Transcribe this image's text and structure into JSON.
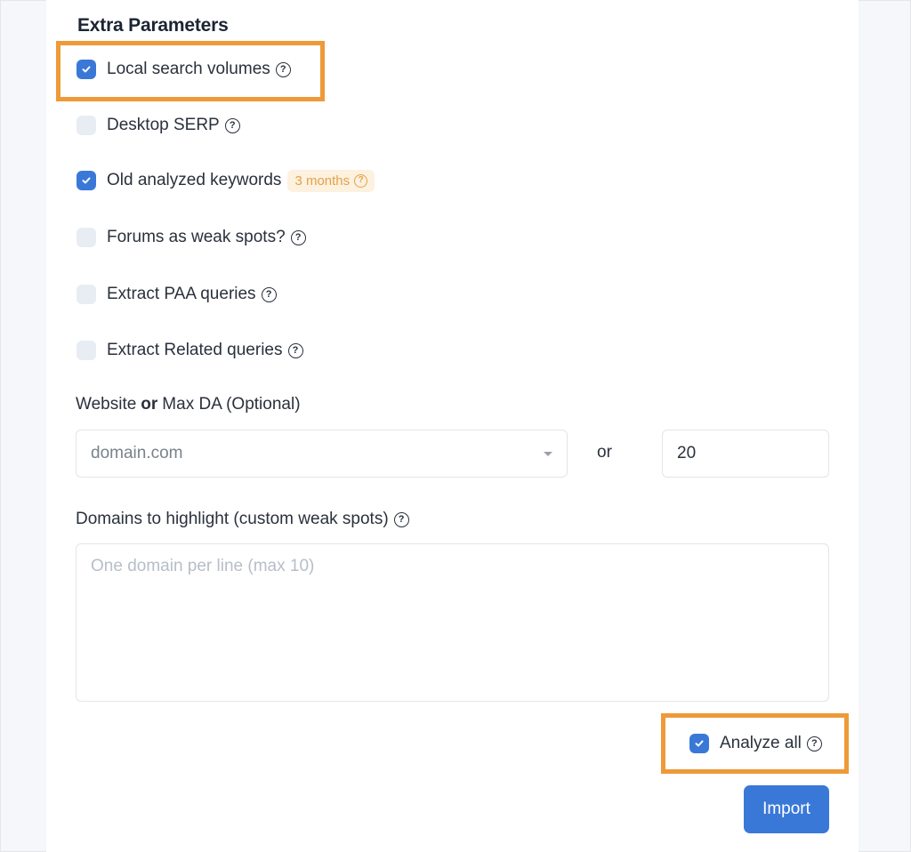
{
  "extra_parameters": {
    "title": "Extra Parameters",
    "options": [
      {
        "label": "Local search volumes",
        "checked": true,
        "help": "?"
      },
      {
        "label": "Desktop SERP",
        "checked": false,
        "help": "?"
      },
      {
        "label": "Old analyzed keywords",
        "checked": true,
        "badge": "3 months"
      },
      {
        "label": "Forums as weak spots?",
        "checked": false,
        "help": "?"
      },
      {
        "label": "Extract PAA queries",
        "checked": false,
        "help": "?"
      },
      {
        "label": "Extract Related queries",
        "checked": false,
        "help": "?"
      }
    ]
  },
  "website_field": {
    "label_part1": "Website",
    "label_bold": "or",
    "label_part2": "Max DA (Optional)",
    "select_value": "domain.com",
    "or_text": "or",
    "max_da_value": "20"
  },
  "domains_field": {
    "label": "Domains to highlight (custom weak spots)",
    "placeholder": "One domain per line (max 10)"
  },
  "analyze_all": {
    "label": "Analyze all",
    "checked": true
  },
  "import_button": {
    "label": "Import"
  },
  "colors": {
    "accent": "#3a78d8",
    "highlight": "#ee9a38",
    "badge_bg": "#fdf1df",
    "badge_text": "#e2a24a"
  }
}
